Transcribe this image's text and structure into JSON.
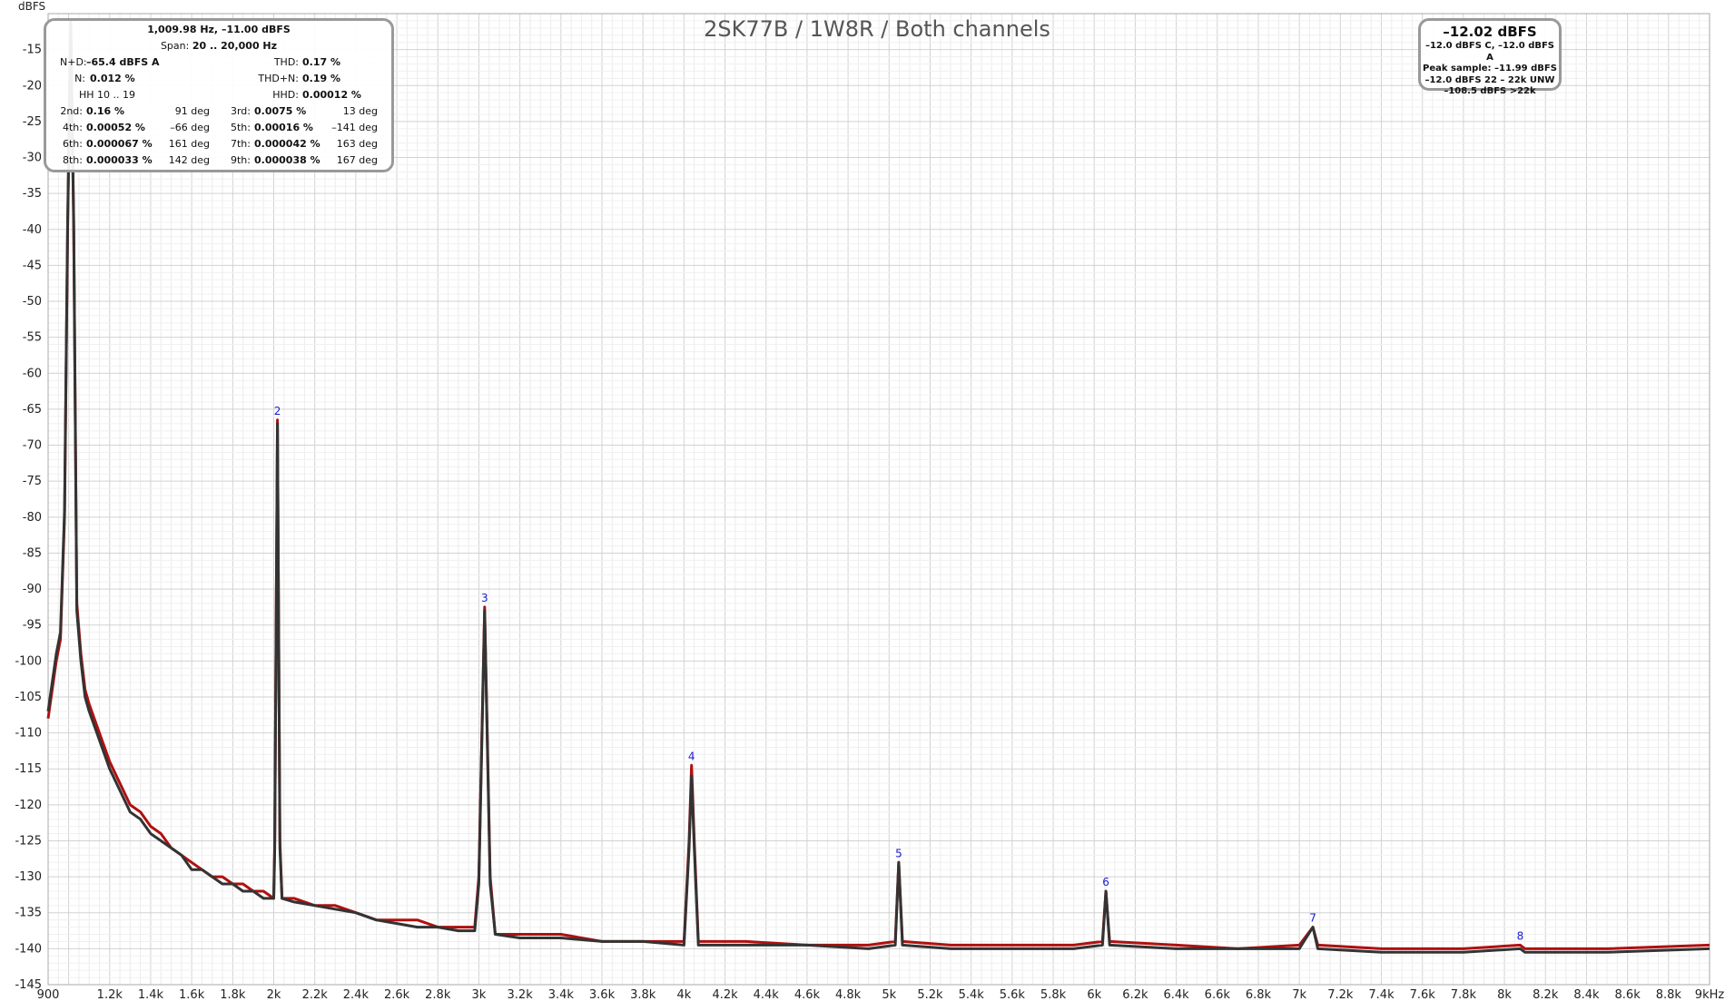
{
  "chart_data": {
    "type": "line",
    "title": "2SK77B / 1W8R / Both channels",
    "ylabel": "dBFS",
    "xlabel": "",
    "x_scale": "linear",
    "xlim": [
      900,
      9000
    ],
    "ylim": [
      -145,
      -10
    ],
    "grid": true,
    "x_ticks": [
      900,
      1200,
      1400,
      1600,
      1800,
      2000,
      2200,
      2400,
      2600,
      2800,
      3000,
      3200,
      3400,
      3600,
      3800,
      4000,
      4200,
      4400,
      4600,
      4800,
      5000,
      5200,
      5400,
      5600,
      5800,
      6000,
      6200,
      6400,
      6600,
      6800,
      7000,
      7200,
      7400,
      7600,
      7800,
      8000,
      8200,
      8400,
      8600,
      8800,
      9000
    ],
    "x_tick_labels": [
      "900",
      "1.2k",
      "1.4k",
      "1.6k",
      "1.8k",
      "2k",
      "2.2k",
      "2.4k",
      "2.6k",
      "2.8k",
      "3k",
      "3.2k",
      "3.4k",
      "3.6k",
      "3.8k",
      "4k",
      "4.2k",
      "4.4k",
      "4.6k",
      "4.8k",
      "5k",
      "5.2k",
      "5.4k",
      "5.6k",
      "5.8k",
      "6k",
      "6.2k",
      "6.4k",
      "6.6k",
      "6.8k",
      "7k",
      "7.2k",
      "7.4k",
      "7.6k",
      "7.8k",
      "8k",
      "8.2k",
      "8.4k",
      "8.6k",
      "8.8k",
      "9kHz"
    ],
    "y_ticks": [
      -15,
      -20,
      -25,
      -30,
      -35,
      -40,
      -45,
      -50,
      -55,
      -60,
      -65,
      -70,
      -75,
      -80,
      -85,
      -90,
      -95,
      -100,
      -105,
      -110,
      -115,
      -120,
      -125,
      -130,
      -135,
      -140,
      -145
    ],
    "y_tick_labels": [
      "-15",
      "-20",
      "-25",
      "-30",
      "-35",
      "-40",
      "-45",
      "-50",
      "-55",
      "-60",
      "-65",
      "-70",
      "-75",
      "-80",
      "-85",
      "-90",
      "-95",
      "-100",
      "-105",
      "-110",
      "-115",
      "-120",
      "-125",
      "-130",
      "-135",
      "-140",
      "-145"
    ],
    "series": [
      {
        "color": "#b01010",
        "points": [
          [
            900,
            -108
          ],
          [
            920,
            -104
          ],
          [
            940,
            -100
          ],
          [
            960,
            -97
          ],
          [
            980,
            -80
          ],
          [
            995,
            -40
          ],
          [
            1010,
            -11
          ],
          [
            1025,
            -40
          ],
          [
            1040,
            -92
          ],
          [
            1060,
            -99
          ],
          [
            1080,
            -104
          ],
          [
            1100,
            -106
          ],
          [
            1150,
            -110
          ],
          [
            1200,
            -114
          ],
          [
            1250,
            -117
          ],
          [
            1300,
            -120
          ],
          [
            1350,
            -121
          ],
          [
            1400,
            -123
          ],
          [
            1450,
            -124
          ],
          [
            1500,
            -126
          ],
          [
            1550,
            -127
          ],
          [
            1600,
            -128
          ],
          [
            1650,
            -129
          ],
          [
            1700,
            -130
          ],
          [
            1750,
            -130
          ],
          [
            1800,
            -131
          ],
          [
            1850,
            -131
          ],
          [
            1900,
            -132
          ],
          [
            1950,
            -132
          ],
          [
            2000,
            -133
          ],
          [
            2005,
            -125
          ],
          [
            2018,
            -66.5
          ],
          [
            2030,
            -125
          ],
          [
            2040,
            -133
          ],
          [
            2100,
            -133
          ],
          [
            2200,
            -134
          ],
          [
            2300,
            -134
          ],
          [
            2400,
            -135
          ],
          [
            2500,
            -136
          ],
          [
            2600,
            -136
          ],
          [
            2700,
            -136
          ],
          [
            2800,
            -137
          ],
          [
            2900,
            -137
          ],
          [
            2980,
            -137
          ],
          [
            3000,
            -130
          ],
          [
            3028,
            -92.5
          ],
          [
            3055,
            -130
          ],
          [
            3080,
            -138
          ],
          [
            3200,
            -138
          ],
          [
            3400,
            -138
          ],
          [
            3600,
            -139
          ],
          [
            3800,
            -139
          ],
          [
            4000,
            -139
          ],
          [
            4025,
            -125
          ],
          [
            4037,
            -114.5
          ],
          [
            4050,
            -125
          ],
          [
            4070,
            -139
          ],
          [
            4300,
            -139
          ],
          [
            4600,
            -139.5
          ],
          [
            4900,
            -139.5
          ],
          [
            5030,
            -139
          ],
          [
            5047,
            -128
          ],
          [
            5065,
            -139
          ],
          [
            5300,
            -139.5
          ],
          [
            5600,
            -139.5
          ],
          [
            5900,
            -139.5
          ],
          [
            6040,
            -139
          ],
          [
            6057,
            -132
          ],
          [
            6075,
            -139
          ],
          [
            6400,
            -139.5
          ],
          [
            6700,
            -140
          ],
          [
            7000,
            -139.5
          ],
          [
            7066,
            -137
          ],
          [
            7090,
            -139.5
          ],
          [
            7400,
            -140
          ],
          [
            7800,
            -140
          ],
          [
            8077,
            -139.5
          ],
          [
            8100,
            -140
          ],
          [
            8500,
            -140
          ],
          [
            9000,
            -139.5
          ]
        ]
      },
      {
        "color": "#333333",
        "points": [
          [
            900,
            -107
          ],
          [
            920,
            -103
          ],
          [
            940,
            -99
          ],
          [
            960,
            -96
          ],
          [
            980,
            -79
          ],
          [
            995,
            -39
          ],
          [
            1010,
            -11
          ],
          [
            1025,
            -39
          ],
          [
            1040,
            -93
          ],
          [
            1060,
            -100
          ],
          [
            1080,
            -105
          ],
          [
            1100,
            -107
          ],
          [
            1150,
            -111
          ],
          [
            1200,
            -115
          ],
          [
            1250,
            -118
          ],
          [
            1300,
            -121
          ],
          [
            1350,
            -122
          ],
          [
            1400,
            -124
          ],
          [
            1450,
            -125
          ],
          [
            1500,
            -126
          ],
          [
            1550,
            -127
          ],
          [
            1600,
            -129
          ],
          [
            1650,
            -129
          ],
          [
            1700,
            -130
          ],
          [
            1750,
            -131
          ],
          [
            1800,
            -131
          ],
          [
            1850,
            -132
          ],
          [
            1900,
            -132
          ],
          [
            1950,
            -133
          ],
          [
            2000,
            -133
          ],
          [
            2005,
            -126
          ],
          [
            2018,
            -67
          ],
          [
            2030,
            -126
          ],
          [
            2040,
            -133
          ],
          [
            2100,
            -133.5
          ],
          [
            2200,
            -134
          ],
          [
            2300,
            -134.5
          ],
          [
            2400,
            -135
          ],
          [
            2500,
            -136
          ],
          [
            2600,
            -136.5
          ],
          [
            2700,
            -137
          ],
          [
            2800,
            -137
          ],
          [
            2900,
            -137.5
          ],
          [
            2980,
            -137.5
          ],
          [
            3000,
            -131
          ],
          [
            3028,
            -93
          ],
          [
            3055,
            -131
          ],
          [
            3080,
            -138
          ],
          [
            3200,
            -138.5
          ],
          [
            3400,
            -138.5
          ],
          [
            3600,
            -139
          ],
          [
            3800,
            -139
          ],
          [
            4000,
            -139.5
          ],
          [
            4025,
            -126
          ],
          [
            4037,
            -116
          ],
          [
            4050,
            -126
          ],
          [
            4070,
            -139.5
          ],
          [
            4300,
            -139.5
          ],
          [
            4600,
            -139.5
          ],
          [
            4900,
            -140
          ],
          [
            5030,
            -139.5
          ],
          [
            5047,
            -128
          ],
          [
            5065,
            -139.5
          ],
          [
            5300,
            -140
          ],
          [
            5600,
            -140
          ],
          [
            5900,
            -140
          ],
          [
            6040,
            -139.5
          ],
          [
            6057,
            -132
          ],
          [
            6075,
            -139.5
          ],
          [
            6400,
            -140
          ],
          [
            6700,
            -140
          ],
          [
            7000,
            -140
          ],
          [
            7066,
            -137
          ],
          [
            7090,
            -140
          ],
          [
            7400,
            -140.5
          ],
          [
            7800,
            -140.5
          ],
          [
            8077,
            -140
          ],
          [
            8100,
            -140.5
          ],
          [
            8500,
            -140.5
          ],
          [
            9000,
            -140
          ]
        ]
      }
    ],
    "harmonic_markers": [
      {
        "label": "2",
        "x": 2018,
        "y": -66.5
      },
      {
        "label": "3",
        "x": 3028,
        "y": -92.5
      },
      {
        "label": "4",
        "x": 4037,
        "y": -114.5
      },
      {
        "label": "5",
        "x": 5047,
        "y": -128
      },
      {
        "label": "6",
        "x": 6057,
        "y": -132
      },
      {
        "label": "7",
        "x": 7066,
        "y": -137
      },
      {
        "label": "8",
        "x": 8077,
        "y": -139.5
      }
    ]
  },
  "stats": {
    "header": "1,009.98 Hz, –11.00 dBFS",
    "span_label": "Span:",
    "span_value": "20 .. 20,000 Hz",
    "nd_label": "N+D:",
    "nd_value": "–65.4 dBFS A",
    "thd_label": "THD:",
    "thd_value": "0.17 %",
    "n_label": "N:",
    "n_value": "0.012 %",
    "thdn_label": "THD+N:",
    "thdn_value": "0.19 %",
    "hh_label": "HH 10 .. 19",
    "hhd_label": "HHD:",
    "hhd_value": "0.00012 %",
    "harmonics": [
      {
        "label": "2nd:",
        "value": "0.16 %",
        "phase": "91 deg"
      },
      {
        "label": "3rd:",
        "value": "0.0075 %",
        "phase": "13 deg"
      },
      {
        "label": "4th:",
        "value": "0.00052 %",
        "phase": "–66 deg"
      },
      {
        "label": "5th:",
        "value": "0.00016 %",
        "phase": "–141 deg"
      },
      {
        "label": "6th:",
        "value": "0.000067 %",
        "phase": "161 deg"
      },
      {
        "label": "7th:",
        "value": "0.000042 %",
        "phase": "163 deg"
      },
      {
        "label": "8th:",
        "value": "0.000033 %",
        "phase": "142 deg"
      },
      {
        "label": "9th:",
        "value": "0.000038 %",
        "phase": "167 deg"
      }
    ]
  },
  "level": {
    "main": "–12.02 dBFS",
    "line1": "–12.0 dBFS C, –12.0 dBFS A",
    "line2": "Peak sample: –11.99 dBFS",
    "line3": "–12.0 dBFS 22 – 22k UNW",
    "line4": "–108.5 dBFS >22k"
  }
}
